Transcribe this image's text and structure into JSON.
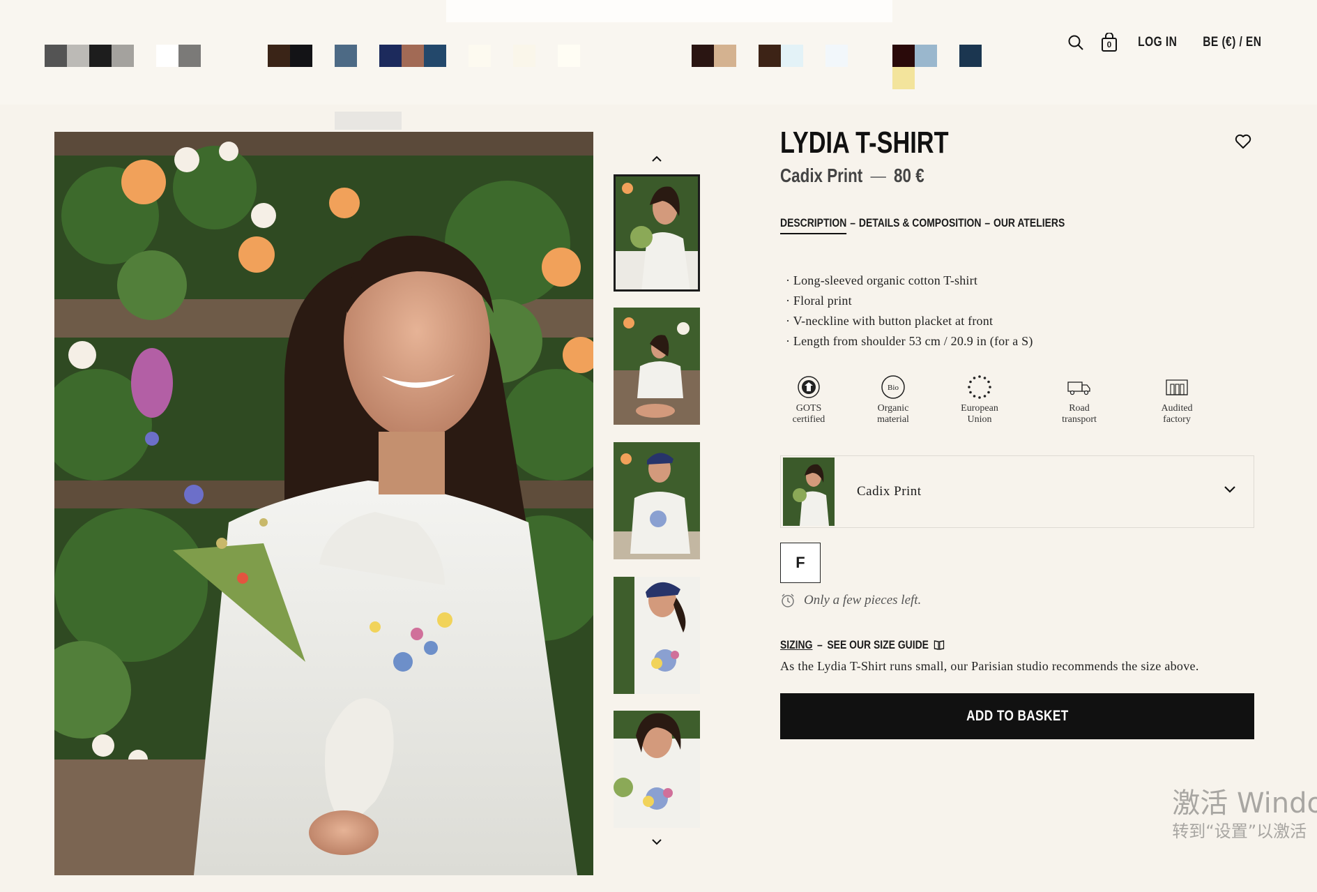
{
  "header": {
    "swatch_colors": [
      "#545454",
      "#bcbab6",
      "#1d1d1d",
      "#a4a29e",
      "#ffffff",
      "#7b7a78",
      "#3a2417",
      "#131316",
      "#4d6a85",
      "#1c2a5c",
      "#a26a55",
      "#23486b",
      "#fdfaf0",
      "#faf6ea",
      "#fffdf4",
      "#2a1512",
      "#d4b290",
      "#3d2316",
      "#e3f2f7",
      "#f2f7fb",
      "#2a0a0a",
      "#9ab7cd",
      "#f3e49c",
      "#1b3650"
    ],
    "login": "LOG IN",
    "locale": "BE (€) / EN",
    "basket_count": "0"
  },
  "product": {
    "title": "LYDIA T-SHIRT",
    "variant": "Cadix Print",
    "dash": "—",
    "price": "80 €"
  },
  "tabs": [
    {
      "label": "DESCRIPTION"
    },
    {
      "label": "DETAILS & COMPOSITION"
    },
    {
      "label": "OUR ATELIERS"
    }
  ],
  "tab_separator": "–",
  "description": [
    "Long-sleeved organic cotton T-shirt",
    "Floral print",
    "V-neckline with button placket at front",
    "Length from shoulder 53 cm / 20.9 in (for a S)"
  ],
  "badges": [
    {
      "icon": "gots-icon",
      "line1": "GOTS",
      "line2": "certified"
    },
    {
      "icon": "bio-icon",
      "line1": "Organic",
      "line2": "material",
      "icon_text": "Bio"
    },
    {
      "icon": "eu-stars-icon",
      "line1": "European",
      "line2": "Union"
    },
    {
      "icon": "truck-icon",
      "line1": "Road",
      "line2": "transport"
    },
    {
      "icon": "factory-icon",
      "line1": "Audited",
      "line2": "factory"
    }
  ],
  "variant_selector": {
    "label": "Cadix Print"
  },
  "size": {
    "selected": "F"
  },
  "stock_note": "Only a few pieces left.",
  "sizing": {
    "label": "SIZING",
    "dash": "–",
    "guide": "SEE OUR SIZE GUIDE",
    "advice": "As the Lydia T-Shirt runs small, our Parisian studio recommends the size above."
  },
  "add_to_basket": "ADD TO BASKET",
  "watermark": {
    "line1": "激活 Windo",
    "line2": "转到“设置”以激活"
  }
}
